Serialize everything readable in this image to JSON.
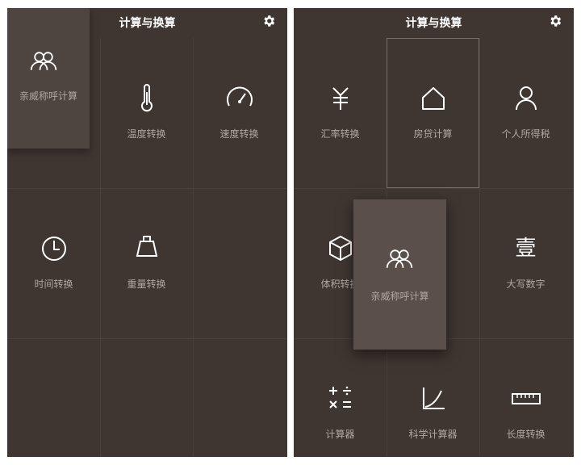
{
  "left": {
    "title": "计算与换算",
    "gear": "gear-icon",
    "items": [
      {
        "label": "亲威称呼计算",
        "icon": "relatives-icon"
      },
      {
        "label": "温度转换",
        "icon": "thermometer-icon"
      },
      {
        "label": "速度转换",
        "icon": "speedometer-icon"
      },
      {
        "label": "时间转换",
        "icon": "clock-icon"
      },
      {
        "label": "重量转换",
        "icon": "weight-icon"
      }
    ]
  },
  "right": {
    "title": "计算与换算",
    "gear": "gear-icon",
    "items": [
      {
        "label": "汇率转换",
        "icon": "yen-icon"
      },
      {
        "label": "房贷计算",
        "icon": "house-icon"
      },
      {
        "label": "个人所得税",
        "icon": "person-icon"
      },
      {
        "label": "体积转换",
        "icon": "cube-icon"
      },
      {
        "label": "亲威称呼计算",
        "icon": "relatives-icon"
      },
      {
        "label": "大写数字",
        "icon": "chinese-numeral-icon",
        "glyph": "壹"
      },
      {
        "label": "计算器",
        "icon": "calculator-icon"
      },
      {
        "label": "科学计算器",
        "icon": "curve-icon"
      },
      {
        "label": "长度转换",
        "icon": "ruler-icon"
      }
    ]
  },
  "colors": {
    "panel_bg": "#3f3531",
    "grid_line": "#4a3f3a",
    "icon": "#ffffff",
    "label": "#b1a7a2"
  }
}
